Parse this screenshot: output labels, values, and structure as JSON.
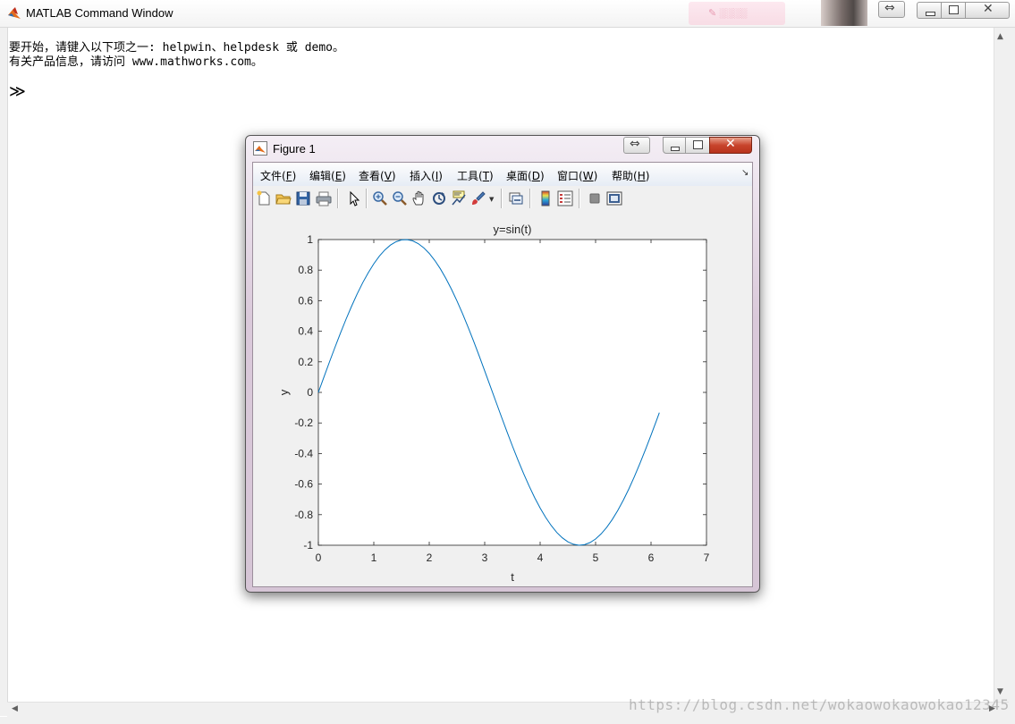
{
  "command_window": {
    "title": "MATLAB Command Window",
    "line1": "要开始，请键入以下项之一: helpwin、helpdesk 或 demo。",
    "line2": "有关产品信息，请访问 www.mathworks.com。",
    "prompt": "≫",
    "undock_glyph": "⇔",
    "watermark": "https://blog.csdn.net/wokaowokaowokao12345"
  },
  "figure_window": {
    "title": "Figure 1",
    "undock_glyph": "⇔",
    "menus": [
      {
        "label": "文件",
        "key": "F"
      },
      {
        "label": "编辑",
        "key": "E"
      },
      {
        "label": "查看",
        "key": "V"
      },
      {
        "label": "插入",
        "key": "I"
      },
      {
        "label": "工具",
        "key": "T"
      },
      {
        "label": "桌面",
        "key": "D"
      },
      {
        "label": "窗口",
        "key": "W"
      },
      {
        "label": "帮助",
        "key": "H"
      }
    ],
    "tools": [
      "new-figure-icon",
      "open-file-icon",
      "save-icon",
      "print-icon",
      "pointer-icon",
      "zoom-in-icon",
      "zoom-out-icon",
      "pan-icon",
      "rotate-3d-icon",
      "data-cursor-icon",
      "brush-icon",
      "link-plot-icon",
      "colorbar-icon",
      "legend-icon",
      "hide-plot-tools-icon",
      "show-plot-tools-icon"
    ]
  },
  "chart_data": {
    "type": "line",
    "title": "y=sin(t)",
    "xlabel": "t",
    "ylabel": "y",
    "xlim": [
      0,
      7
    ],
    "ylim": [
      -1,
      1
    ],
    "xticks": [
      0,
      1,
      2,
      3,
      4,
      5,
      6,
      7
    ],
    "yticks": [
      1,
      0.8,
      0.6,
      0.4,
      0.2,
      0,
      -0.2,
      -0.4,
      -0.6,
      -0.8,
      -1
    ],
    "grid": false,
    "series": [
      {
        "color": "#0072bd",
        "x": [
          0,
          0.1,
          0.2,
          0.3,
          0.4,
          0.5,
          0.6,
          0.7,
          0.8,
          0.9,
          1.0,
          1.1,
          1.2,
          1.3,
          1.4,
          1.5,
          1.6,
          1.7,
          1.8,
          1.9,
          2.0,
          2.1,
          2.2,
          2.3,
          2.4,
          2.5,
          2.6,
          2.7,
          2.8,
          2.9,
          3.0,
          3.1,
          3.2,
          3.3,
          3.4,
          3.5,
          3.6,
          3.7,
          3.8,
          3.9,
          4.0,
          4.1,
          4.2,
          4.3,
          4.4,
          4.5,
          4.6,
          4.7,
          4.8,
          4.9,
          5.0,
          5.1,
          5.2,
          5.3,
          5.4,
          5.5,
          5.6,
          5.7,
          5.8,
          5.9,
          6.0,
          6.1,
          6.15
        ],
        "y": [
          0,
          0.0998,
          0.1987,
          0.2955,
          0.3894,
          0.4794,
          0.5646,
          0.6442,
          0.7174,
          0.7833,
          0.8415,
          0.8912,
          0.932,
          0.9636,
          0.9854,
          0.9975,
          0.9996,
          0.9917,
          0.9738,
          0.9463,
          0.9093,
          0.8632,
          0.8085,
          0.7457,
          0.6755,
          0.5985,
          0.5155,
          0.4274,
          0.335,
          0.2392,
          0.1411,
          0.0416,
          -0.0584,
          -0.1577,
          -0.2555,
          -0.3508,
          -0.4425,
          -0.5298,
          -0.6119,
          -0.6878,
          -0.7568,
          -0.8183,
          -0.8716,
          -0.9162,
          -0.9516,
          -0.9775,
          -0.9937,
          -0.9999,
          -0.9962,
          -0.9825,
          -0.9589,
          -0.9258,
          -0.8835,
          -0.8323,
          -0.7728,
          -0.7055,
          -0.6313,
          -0.5507,
          -0.4646,
          -0.3739,
          -0.2794,
          -0.1822,
          -0.1328
        ]
      }
    ]
  }
}
